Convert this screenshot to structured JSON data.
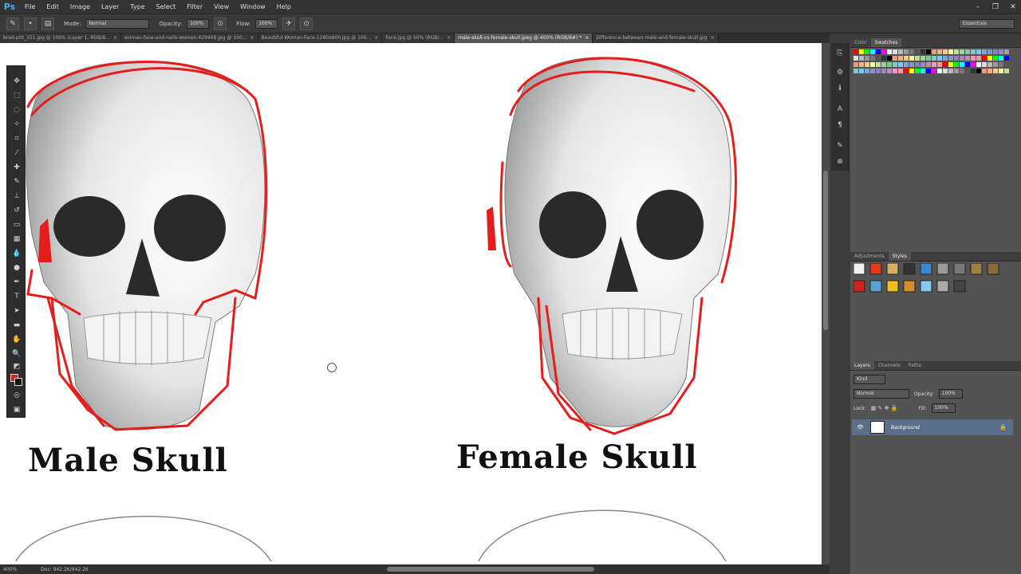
{
  "app": {
    "logo": "Ps"
  },
  "menu": [
    "File",
    "Edit",
    "Image",
    "Layer",
    "Type",
    "Select",
    "Filter",
    "View",
    "Window",
    "Help"
  ],
  "options": {
    "mode_label": "Mode:",
    "mode_value": "Normal",
    "opacity_label": "Opacity:",
    "opacity_value": "100%",
    "flow_label": "Flow:",
    "flow_value": "100%",
    "workspace": "Essentials"
  },
  "tabs": [
    "brad-pitt_151.jpg @ 100% (Layer 1, RGB/8...",
    "woman-face-and-nails-women-429449.jpg @ 100...",
    "Beautiful-Woman-Face-1280x800.jpg @ 100...",
    "Face.jpg @ 50% (RGB/...",
    "male-skull-vs-female-skull.jpeg @ 400% (RGB/8#) *",
    "Difference-between-male-and-female-skull.jpg"
  ],
  "canvas": {
    "male_title": "Male Skull",
    "female_title": "Female Skull"
  },
  "status": {
    "zoom": "400%",
    "doc": "Doc: 942.2K/942.2K"
  },
  "panels": {
    "color_tabs": [
      "Color",
      "Swatches"
    ],
    "style_tabs": [
      "Adjustments",
      "Styles"
    ],
    "layer_tabs": [
      "Layers",
      "Channels",
      "Paths"
    ],
    "kind_label": "Kind",
    "blend_mode": "Normal",
    "opacity_label": "Opacity:",
    "opacity_value": "100%",
    "lock_label": "Lock:",
    "fill_label": "Fill:",
    "fill_value": "100%",
    "layer_name": "Background"
  }
}
